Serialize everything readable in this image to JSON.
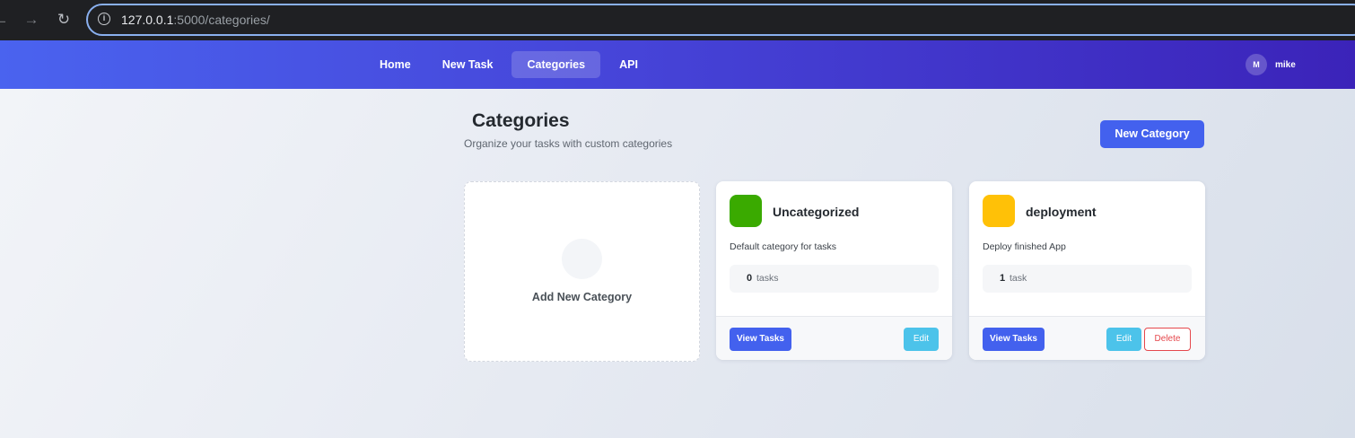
{
  "browser": {
    "url_host": "127.0.0.1",
    "url_rest": ":5000/categories/"
  },
  "nav": {
    "links": [
      "Home",
      "New Task",
      "Categories",
      "API"
    ],
    "active": "Categories",
    "user_initial": "M",
    "username": "mike"
  },
  "page": {
    "title": "Categories",
    "subtitle": "Organize your tasks with custom categories",
    "new_category_label": "New Category",
    "add_card_label": "Add New Category"
  },
  "categories": [
    {
      "name": "Uncategorized",
      "color": "#3aaa00",
      "description": "Default category for tasks",
      "count": "0",
      "unit": "tasks",
      "view_label": "View Tasks",
      "edit_label": "Edit",
      "delete_label": ""
    },
    {
      "name": "deployment",
      "color": "#ffc107",
      "description": "Deploy finished App",
      "count": "1",
      "unit": "task",
      "view_label": "View Tasks",
      "edit_label": "Edit",
      "delete_label": "Delete"
    }
  ],
  "colors": {
    "accent": "#4361ee",
    "info": "#4cc3ea",
    "danger": "#e5484d"
  }
}
